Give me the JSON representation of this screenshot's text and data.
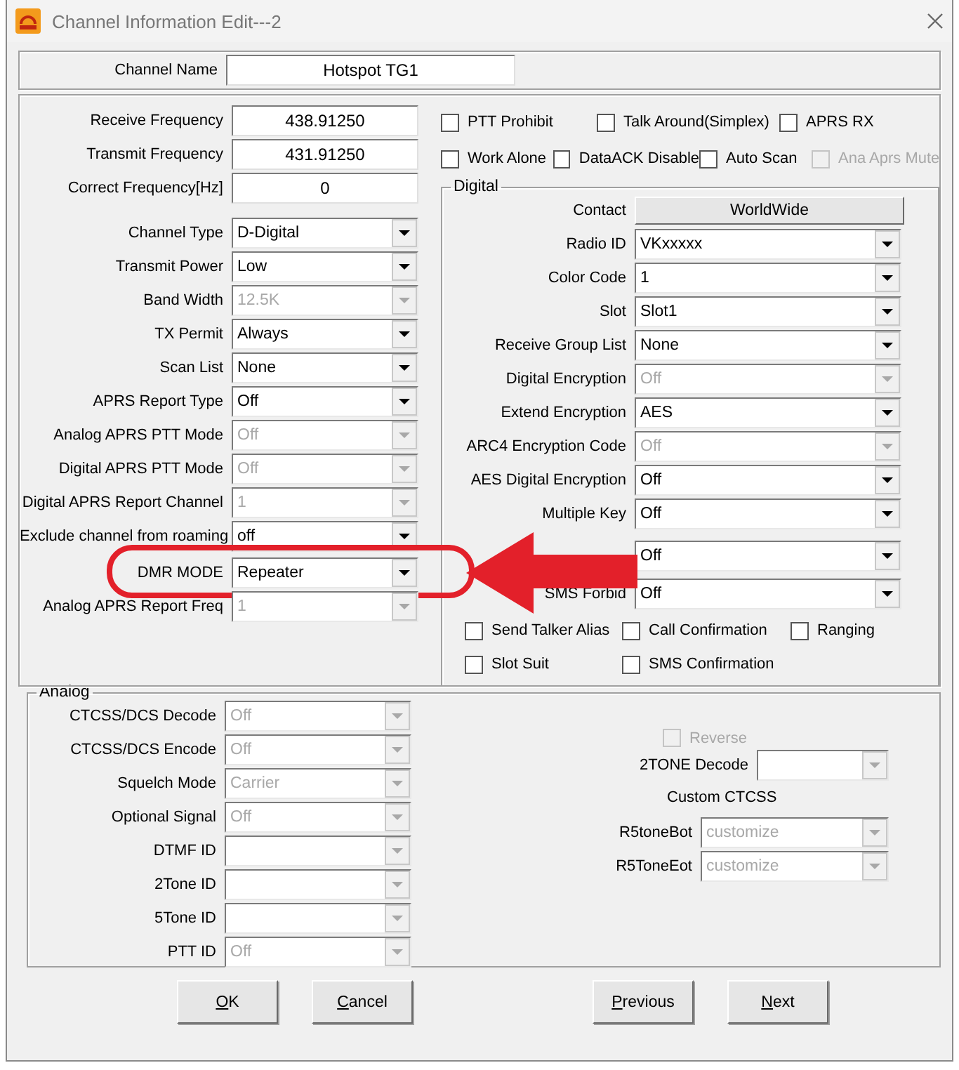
{
  "window": {
    "title": "Channel Information Edit---2"
  },
  "channel_name": {
    "label": "Channel Name",
    "value": "Hotspot TG1"
  },
  "main_fields": [
    {
      "kind": "text",
      "label": "Receive Frequency",
      "value": "438.91250",
      "disabled": false,
      "highlighted": false
    },
    {
      "kind": "text",
      "label": "Transmit Frequency",
      "value": "431.91250",
      "disabled": false,
      "highlighted": false
    },
    {
      "kind": "text",
      "label": "Correct Frequency[Hz]",
      "value": "0",
      "disabled": false,
      "highlighted": false
    },
    {
      "kind": "combo",
      "label": "Channel Type",
      "value": "D-Digital",
      "disabled": false,
      "highlighted": false
    },
    {
      "kind": "combo",
      "label": "Transmit Power",
      "value": "Low",
      "disabled": false,
      "highlighted": false
    },
    {
      "kind": "combo",
      "label": "Band Width",
      "value": "12.5K",
      "disabled": true,
      "highlighted": false
    },
    {
      "kind": "combo",
      "label": "TX Permit",
      "value": "Always",
      "disabled": false,
      "highlighted": false
    },
    {
      "kind": "combo",
      "label": "Scan List",
      "value": "None",
      "disabled": false,
      "highlighted": false
    },
    {
      "kind": "combo",
      "label": "APRS Report Type",
      "value": "Off",
      "disabled": false,
      "highlighted": false
    },
    {
      "kind": "combo",
      "label": "Analog APRS PTT Mode",
      "value": "Off",
      "disabled": true,
      "highlighted": false
    },
    {
      "kind": "combo",
      "label": "Digital APRS PTT Mode",
      "value": "Off",
      "disabled": true,
      "highlighted": false
    },
    {
      "kind": "combo",
      "label": "Digital APRS Report Channel",
      "value": "1",
      "disabled": true,
      "highlighted": false
    },
    {
      "kind": "combo",
      "label": "Exclude channel from roaming",
      "value": "off",
      "disabled": false,
      "highlighted": false
    },
    {
      "kind": "combo",
      "label": "DMR MODE",
      "value": "Repeater",
      "disabled": false,
      "highlighted": true
    },
    {
      "kind": "combo",
      "label": "Analog APRS Report Freq",
      "value": "1",
      "disabled": true,
      "highlighted": false
    }
  ],
  "options": [
    [
      {
        "label": "PTT Prohibit",
        "checked": false,
        "disabled": false
      },
      {
        "label": "Talk Around(Simplex)",
        "checked": false,
        "disabled": false
      },
      {
        "label": "APRS RX",
        "checked": false,
        "disabled": false
      }
    ],
    [
      {
        "label": "Work Alone",
        "checked": false,
        "disabled": false
      },
      {
        "label": "DataACK Disable",
        "checked": false,
        "disabled": false
      },
      {
        "label": "Auto Scan",
        "checked": false,
        "disabled": false
      },
      {
        "label": "Ana Aprs Mute",
        "checked": false,
        "disabled": true
      }
    ]
  ],
  "digital": {
    "title": "Digital",
    "fields": [
      {
        "kind": "button",
        "label": "Contact",
        "value": "WorldWide",
        "disabled": false
      },
      {
        "kind": "combo",
        "label": "Radio ID",
        "value": "VKxxxxx",
        "disabled": false
      },
      {
        "kind": "combo",
        "label": "Color Code",
        "value": "1",
        "disabled": false
      },
      {
        "kind": "combo",
        "label": "Slot",
        "value": "Slot1",
        "disabled": false
      },
      {
        "kind": "combo",
        "label": "Receive Group List",
        "value": "None",
        "disabled": false
      },
      {
        "kind": "combo",
        "label": "Digital Encryption",
        "value": "Off",
        "disabled": true
      },
      {
        "kind": "combo",
        "label": "Extend Encryption",
        "value": "AES",
        "disabled": false
      },
      {
        "kind": "combo",
        "label": "ARC4 Encryption Code",
        "value": "Off",
        "disabled": true
      },
      {
        "kind": "combo",
        "label": "AES Digital Encryption",
        "value": "Off",
        "disabled": false
      },
      {
        "kind": "combo",
        "label": "Multiple Key",
        "value": "Off",
        "disabled": false
      },
      {
        "kind": "combo",
        "value": "Off",
        "disabled": false
      },
      {
        "kind": "combo",
        "label": "SMS Forbid",
        "value": "Off",
        "disabled": false
      }
    ],
    "checkboxes": [
      [
        {
          "label": "Send Talker Alias",
          "checked": false,
          "disabled": false
        },
        {
          "label": "Call Confirmation",
          "checked": false,
          "disabled": false
        },
        {
          "label": "Ranging",
          "checked": false,
          "disabled": false
        }
      ],
      [
        {
          "label": "Slot Suit",
          "checked": false,
          "disabled": false
        },
        {
          "label": "SMS Confirmation",
          "checked": false,
          "disabled": false
        }
      ]
    ]
  },
  "analog": {
    "title": "Analog",
    "fields": [
      {
        "kind": "combo",
        "label": "CTCSS/DCS Decode",
        "value": "Off",
        "disabled": true
      },
      {
        "kind": "combo",
        "label": "CTCSS/DCS Encode",
        "value": "Off",
        "disabled": true
      },
      {
        "kind": "combo",
        "label": "Squelch Mode",
        "value": "Carrier",
        "disabled": true
      },
      {
        "kind": "combo",
        "label": "Optional Signal",
        "value": "Off",
        "disabled": true
      },
      {
        "kind": "combo",
        "label": "DTMF ID",
        "disabled": true
      },
      {
        "kind": "combo",
        "label": "2Tone ID",
        "disabled": true
      },
      {
        "kind": "combo",
        "label": "5Tone ID",
        "disabled": true
      },
      {
        "kind": "combo",
        "label": "PTT ID",
        "value": "Off",
        "disabled": true
      }
    ],
    "reverse": {
      "label": "Reverse",
      "checked": false,
      "disabled": true
    },
    "tone_decode": {
      "kind": "combo",
      "label": "2TONE Decode",
      "disabled": true
    },
    "custom_ctcss": "Custom CTCSS",
    "tone_fields": [
      {
        "kind": "combo",
        "label": "R5toneBot",
        "value": "customize",
        "disabled": true
      },
      {
        "kind": "combo",
        "label": "R5ToneEot",
        "value": "customize",
        "disabled": true
      }
    ]
  },
  "buttons": [
    {
      "label": "OK"
    },
    {
      "label": "Cancel"
    },
    {
      "label": "Previous"
    },
    {
      "label": "Next"
    }
  ]
}
